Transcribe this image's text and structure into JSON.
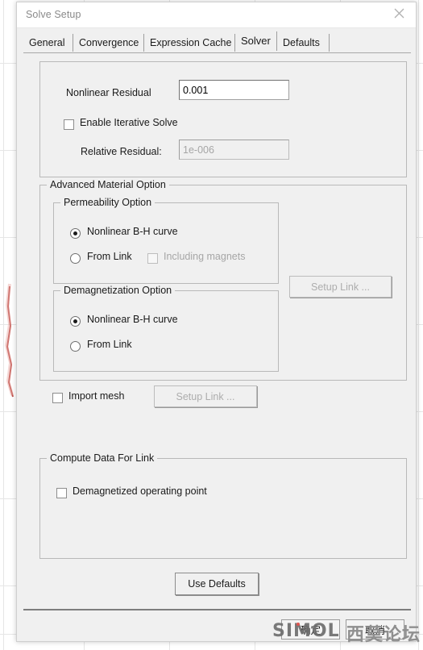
{
  "window": {
    "title": "Solve Setup",
    "close_icon": "close-icon"
  },
  "tabs": [
    {
      "label": "General",
      "selected": false
    },
    {
      "label": "Convergence",
      "selected": false
    },
    {
      "label": "Expression Cache",
      "selected": false
    },
    {
      "label": "Solver",
      "selected": true
    },
    {
      "label": "Defaults",
      "selected": false
    }
  ],
  "residual_group": {
    "nonlinear_residual_label": "Nonlinear Residual",
    "nonlinear_residual_value": "0.001",
    "enable_iterative_solve_label": "Enable Iterative Solve",
    "enable_iterative_solve_checked": false,
    "relative_residual_label": "Relative Residual:",
    "relative_residual_value": "1e-006",
    "relative_residual_disabled": true
  },
  "advanced_material": {
    "legend": "Advanced Material Option",
    "permeability": {
      "legend": "Permeability Option",
      "options": [
        {
          "label": "Nonlinear B-H curve",
          "selected": true
        },
        {
          "label": "From Link",
          "selected": false
        }
      ],
      "including_magnets_label": "Including magnets",
      "including_magnets_checked": false,
      "including_magnets_disabled": true
    },
    "demagnetization": {
      "legend": "Demagnetization Option",
      "options": [
        {
          "label": "Nonlinear B-H curve",
          "selected": true
        },
        {
          "label": "From Link",
          "selected": false
        }
      ]
    },
    "setup_link_label": "Setup Link ...",
    "setup_link_disabled": true
  },
  "import_mesh": {
    "label": "Import mesh",
    "checked": false,
    "setup_link_label": "Setup Link ...",
    "setup_link_disabled": true
  },
  "compute_data": {
    "legend": "Compute Data For Link",
    "demagnetized_operating_point_label": "Demagnetized operating point",
    "demagnetized_operating_point_checked": false
  },
  "use_defaults_label": "Use Defaults",
  "footer": {
    "ok_label": "确定",
    "cancel_label": "取消"
  },
  "watermark": {
    "latin": "SIMOL",
    "chinese": "西莫论坛"
  },
  "colors": {
    "dialog_bg": "#f0f0f0",
    "titlebar_bg": "#ffffff",
    "border": "#b9b9b9",
    "disabled_text": "#a6a6a6",
    "background_curve": "#c0392b"
  }
}
